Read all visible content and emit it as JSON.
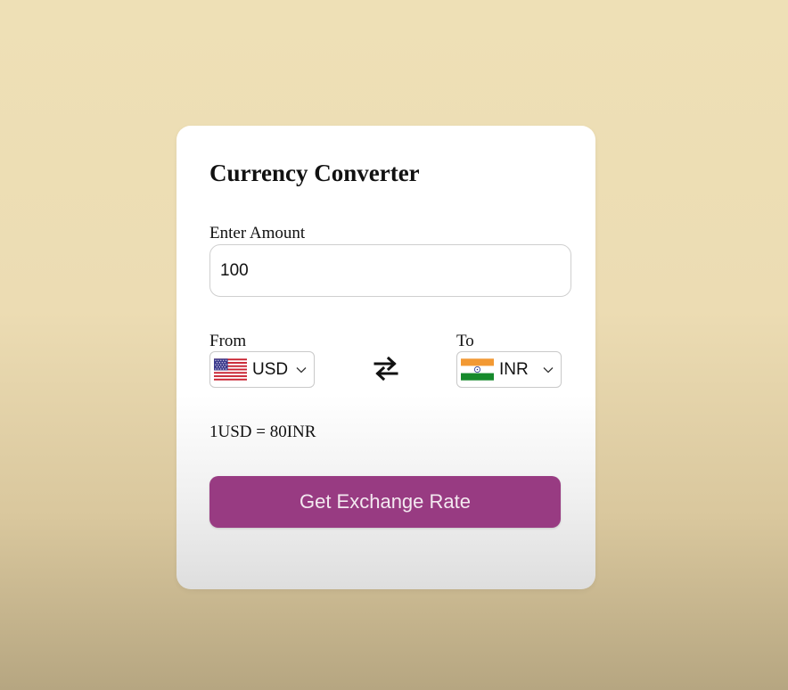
{
  "title": "Currency Converter",
  "amount": {
    "label": "Enter Amount",
    "value": "100"
  },
  "from": {
    "label": "From",
    "currency": "USD",
    "flag": "us-flag-icon"
  },
  "to": {
    "label": "To",
    "currency": "INR",
    "flag": "india-flag-icon"
  },
  "swap_icon": "swap-arrows-icon",
  "rate_text": "1USD = 80INR",
  "button_label": "Get Exchange Rate",
  "colors": {
    "background": "#eee0b6",
    "card": "#ffffff",
    "button": "#983b82",
    "button_text": "#f3e9f0"
  }
}
